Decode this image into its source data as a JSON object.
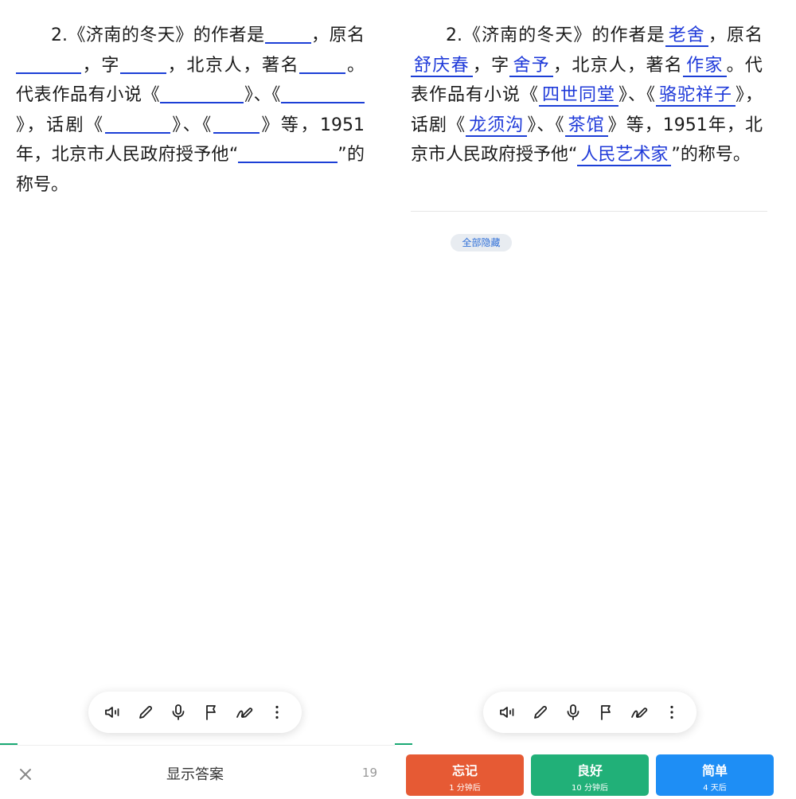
{
  "question": {
    "num": "2.",
    "t1": "《济南的冬天》的作者是",
    "t2": "，原名",
    "t3": "，字",
    "t4": "，北京人，著名",
    "t5": "。代表作品有小说《",
    "t6": "》、《",
    "t7": "》，话剧《",
    "t8": "》、《",
    "t9": "》等，1951年，北京市人民政府授予他“",
    "t10": "”的称号。"
  },
  "answers": {
    "author": "老舍",
    "original_name": "舒庆春",
    "courtesy_name": "舍予",
    "title": "作家",
    "novel1": "四世同堂",
    "novel2": "骆驼祥子",
    "play1": "龙须沟",
    "play2": "茶馆",
    "honor": "人民艺术家"
  },
  "hide_all_label": "全部隐藏",
  "toolbar": {
    "icons": [
      "speaker-icon",
      "pencil-icon",
      "mic-icon",
      "flag-icon",
      "pen-icon",
      "more-icon"
    ]
  },
  "bottom": {
    "show_answer": "显示答案",
    "count": "19"
  },
  "ratings": {
    "forget": {
      "label": "忘记",
      "sub": "1 分钟后"
    },
    "good": {
      "label": "良好",
      "sub": "10 分钟后"
    },
    "easy": {
      "label": "简单",
      "sub": "4 天后"
    }
  },
  "colors": {
    "answer_blue": "#1f3ad9",
    "forget": "#e65a34",
    "good": "#21b078",
    "easy": "#1e8ef5"
  }
}
